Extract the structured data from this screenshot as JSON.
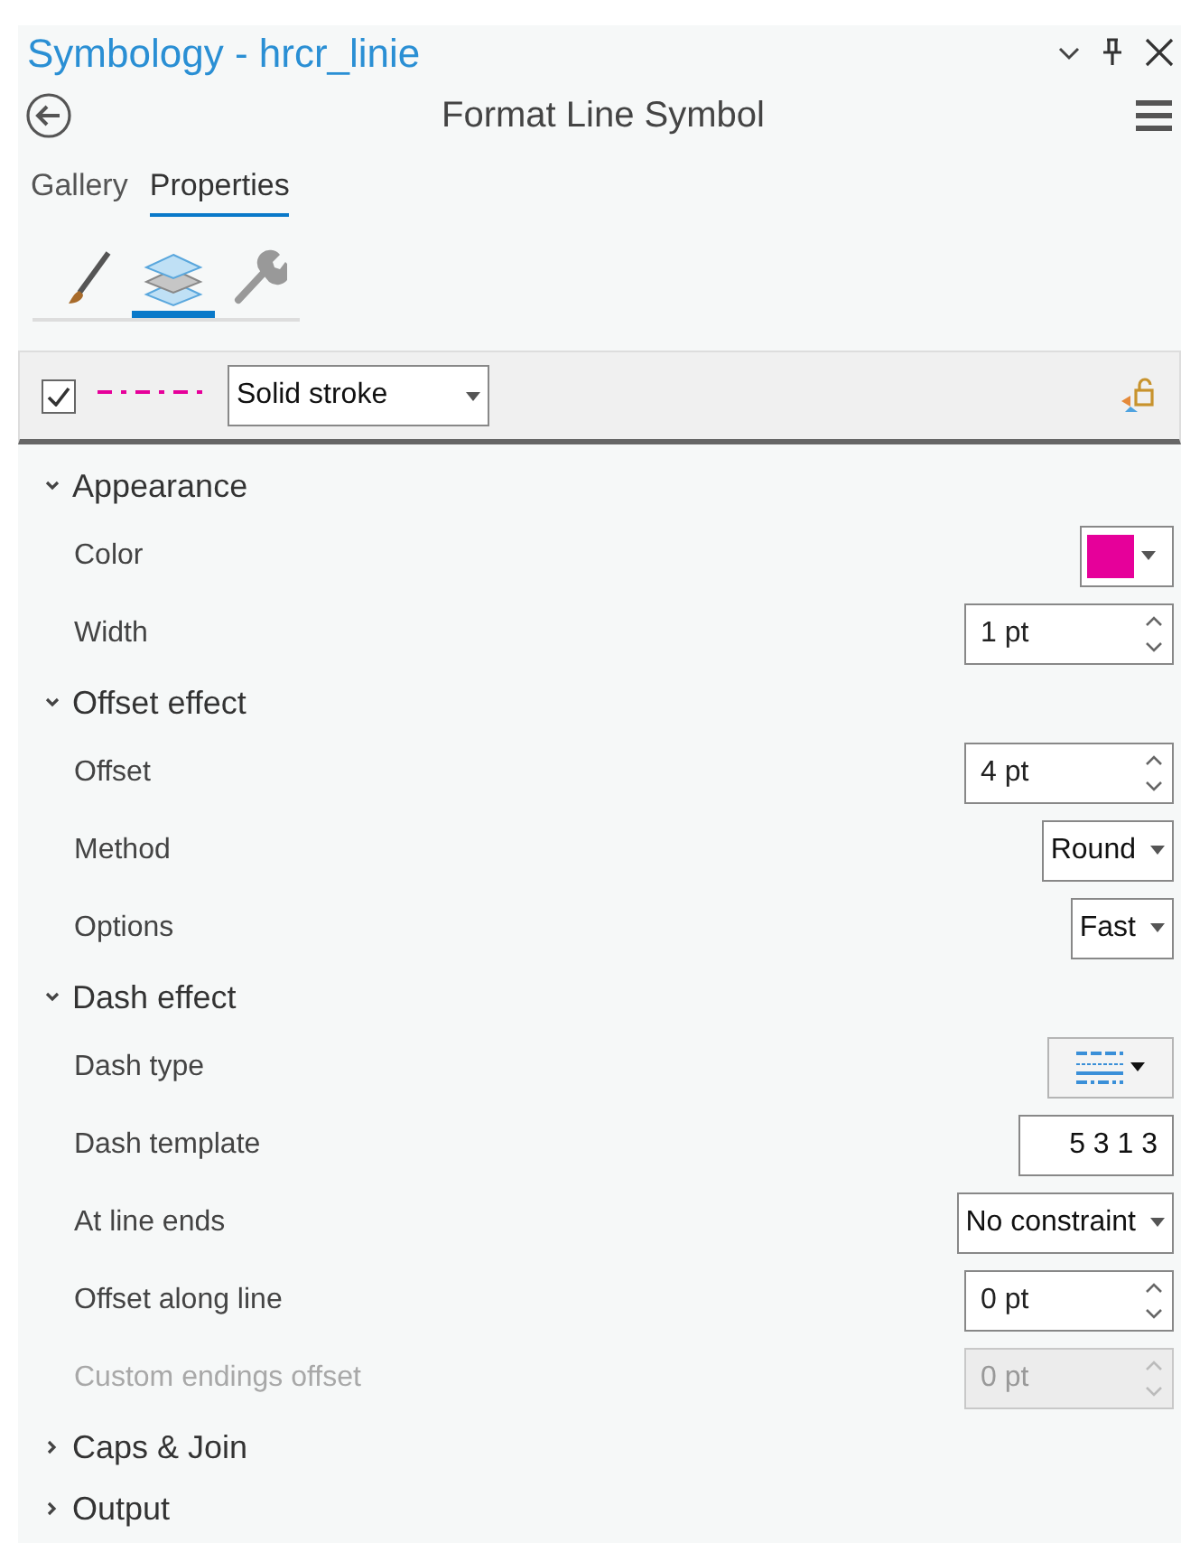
{
  "window": {
    "title": "Symbology - hrcr_linie"
  },
  "header": {
    "title": "Format Line Symbol"
  },
  "tabs": [
    {
      "label": "Gallery",
      "selected": false
    },
    {
      "label": "Properties",
      "selected": true
    }
  ],
  "tool_tabs": [
    {
      "kind": "brush",
      "selected": false
    },
    {
      "kind": "layers",
      "selected": true
    },
    {
      "kind": "wrench",
      "selected": false
    }
  ],
  "layer": {
    "checked": true,
    "type": "Solid stroke"
  },
  "sections": [
    {
      "title": "Appearance",
      "expanded": true,
      "items": [
        {
          "label": "Color",
          "kind": "color",
          "color": "#e6009a",
          "disabled": false
        },
        {
          "label": "Width",
          "kind": "spin",
          "value": "1 pt",
          "disabled": false
        }
      ]
    },
    {
      "title": "Offset effect",
      "expanded": true,
      "items": [
        {
          "label": "Offset",
          "kind": "spin",
          "value": "4 pt",
          "disabled": false
        },
        {
          "label": "Method",
          "kind": "dropdown",
          "value": "Round",
          "disabled": false
        },
        {
          "label": "Options",
          "kind": "dropdown",
          "value": "Fast",
          "disabled": false
        }
      ]
    },
    {
      "title": "Dash effect",
      "expanded": true,
      "items": [
        {
          "label": "Dash type",
          "kind": "dashtype",
          "disabled": false
        },
        {
          "label": "Dash template",
          "kind": "text",
          "value": "5 3 1 3",
          "disabled": false
        },
        {
          "label": "At line ends",
          "kind": "dropdown",
          "value": "No constraint",
          "disabled": false
        },
        {
          "label": "Offset along line",
          "kind": "spin",
          "value": "0 pt",
          "disabled": false
        },
        {
          "label": "Custom endings offset",
          "kind": "spin",
          "value": "0 pt",
          "disabled": true
        }
      ]
    },
    {
      "title": "Caps & Join",
      "expanded": false
    },
    {
      "title": "Output",
      "expanded": false
    }
  ]
}
